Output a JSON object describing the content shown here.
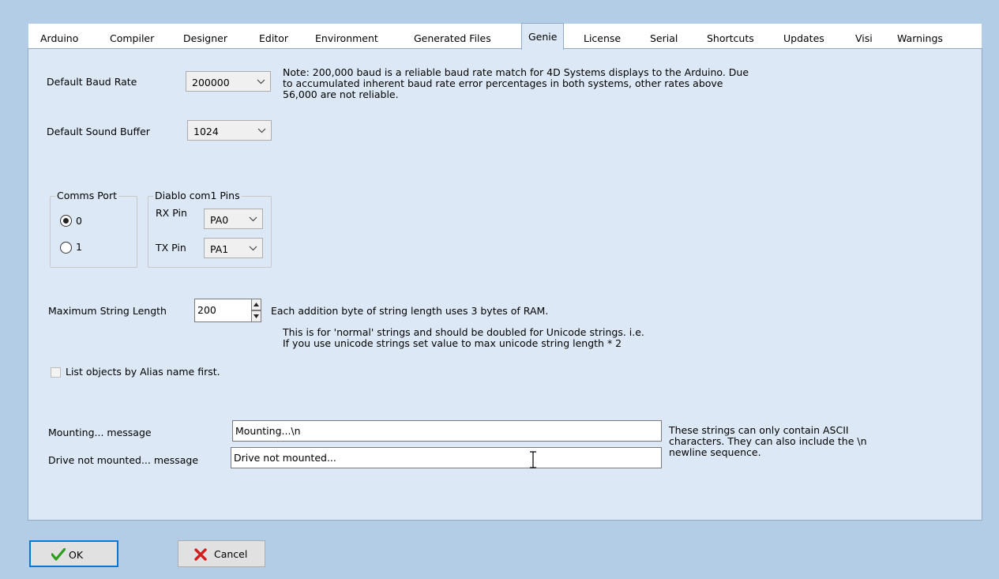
{
  "tabs": [
    {
      "label": "Arduino"
    },
    {
      "label": "Compiler"
    },
    {
      "label": "Designer"
    },
    {
      "label": "Editor"
    },
    {
      "label": "Environment"
    },
    {
      "label": "Generated Files"
    },
    {
      "label": "Genie",
      "active": true
    },
    {
      "label": "License"
    },
    {
      "label": "Serial"
    },
    {
      "label": "Shortcuts"
    },
    {
      "label": "Updates"
    },
    {
      "label": "Visi"
    },
    {
      "label": "Warnings"
    }
  ],
  "genie": {
    "baud": {
      "label": "Default Baud Rate",
      "value": "200000",
      "note_line1": "Note: 200,000 baud is a reliable baud rate match for 4D Systems displays to the Arduino. Due",
      "note_line2": "to accumulated inherent baud rate error percentages in both systems, other rates above",
      "note_line3": "56,000 are not reliable."
    },
    "sound_buffer": {
      "label": "Default Sound Buffer",
      "value": "1024"
    },
    "comms_port": {
      "label": "Comms Port",
      "options": [
        {
          "label": "0",
          "selected": true
        },
        {
          "label": "1",
          "selected": false
        }
      ]
    },
    "diablo_pins": {
      "label": "Diablo com1 Pins",
      "rx_label": "RX Pin",
      "rx_value": "PA0",
      "tx_label": "TX Pin",
      "tx_value": "PA1"
    },
    "max_string": {
      "label": "Maximum String Length",
      "value": "200",
      "note1": "Each addition byte of string length uses 3 bytes of RAM.",
      "note2": "This is for 'normal' strings and should be doubled for Unicode strings. i.e.",
      "note3": "If you use unicode strings set value to max unicode string length * 2"
    },
    "alias_checkbox": {
      "label": "List objects by Alias name first.",
      "checked": false
    },
    "mounting": {
      "label": "Mounting... message",
      "value": "Mounting...\\n"
    },
    "not_mounted": {
      "label": "Drive not mounted... message",
      "value": "Drive not mounted..."
    },
    "strings_note": {
      "line1": "These strings can only contain ASCII",
      "line2": "characters. They can also include the \\n",
      "line3": "newline sequence."
    }
  },
  "buttons": {
    "ok": "OK",
    "cancel": "Cancel"
  },
  "colors": {
    "panel": "#dce8f5",
    "frame": "#b4cde6",
    "ok_border": "#0078d7",
    "check": "#2e9c1e",
    "cancel_x": "#d01e1e"
  }
}
